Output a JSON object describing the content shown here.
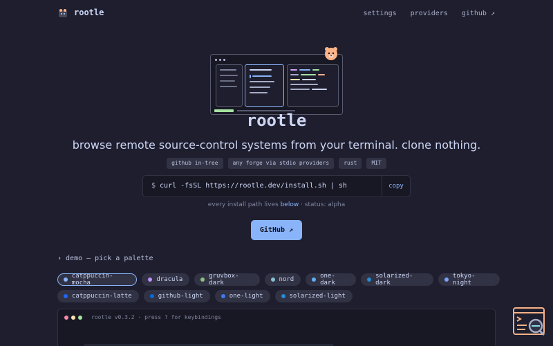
{
  "nav": {
    "brand": "rootle",
    "links": [
      "settings",
      "providers",
      "github ↗"
    ]
  },
  "hero": {
    "title": "rootle",
    "tagline": "browse remote source-control systems from your terminal. clone nothing.",
    "badges": [
      "github in-tree",
      "any forge via stdio providers",
      "rust",
      "MIT"
    ]
  },
  "install": {
    "prompt": "$",
    "command": "curl -fsSL https://rootle.dev/install.sh | sh",
    "copy_label": "copy"
  },
  "note": {
    "prefix": "every install path lives",
    "link": "below",
    "suffix": "· status: alpha"
  },
  "github_button": "GitHub ↗",
  "demo": {
    "chevron": "›",
    "heading": "demo — pick a palette",
    "palettes_row1": [
      {
        "name": "catppuccin-mocha",
        "color": "#89b4fa",
        "active": true
      },
      {
        "name": "dracula",
        "color": "#bd93f9"
      },
      {
        "name": "gruvbox-dark",
        "color": "#8ec07c"
      },
      {
        "name": "nord",
        "color": "#88c0d0"
      },
      {
        "name": "one-dark",
        "color": "#61afef"
      },
      {
        "name": "solarized-dark",
        "color": "#268bd2"
      },
      {
        "name": "tokyo-night",
        "color": "#7aa2f7"
      }
    ],
    "palettes_row2": [
      {
        "name": "catppuccin-latte",
        "color": "#1e66f5"
      },
      {
        "name": "github-light",
        "color": "#0969da"
      },
      {
        "name": "one-light",
        "color": "#4078f2"
      },
      {
        "name": "solarized-light",
        "color": "#268bd2"
      }
    ]
  },
  "terminal": {
    "status_line": "rootle v0.3.2 · press ? for keybindings"
  },
  "colors": {
    "background": "#1e1e2e",
    "accent": "#89b4fa",
    "surface": "#313244"
  }
}
